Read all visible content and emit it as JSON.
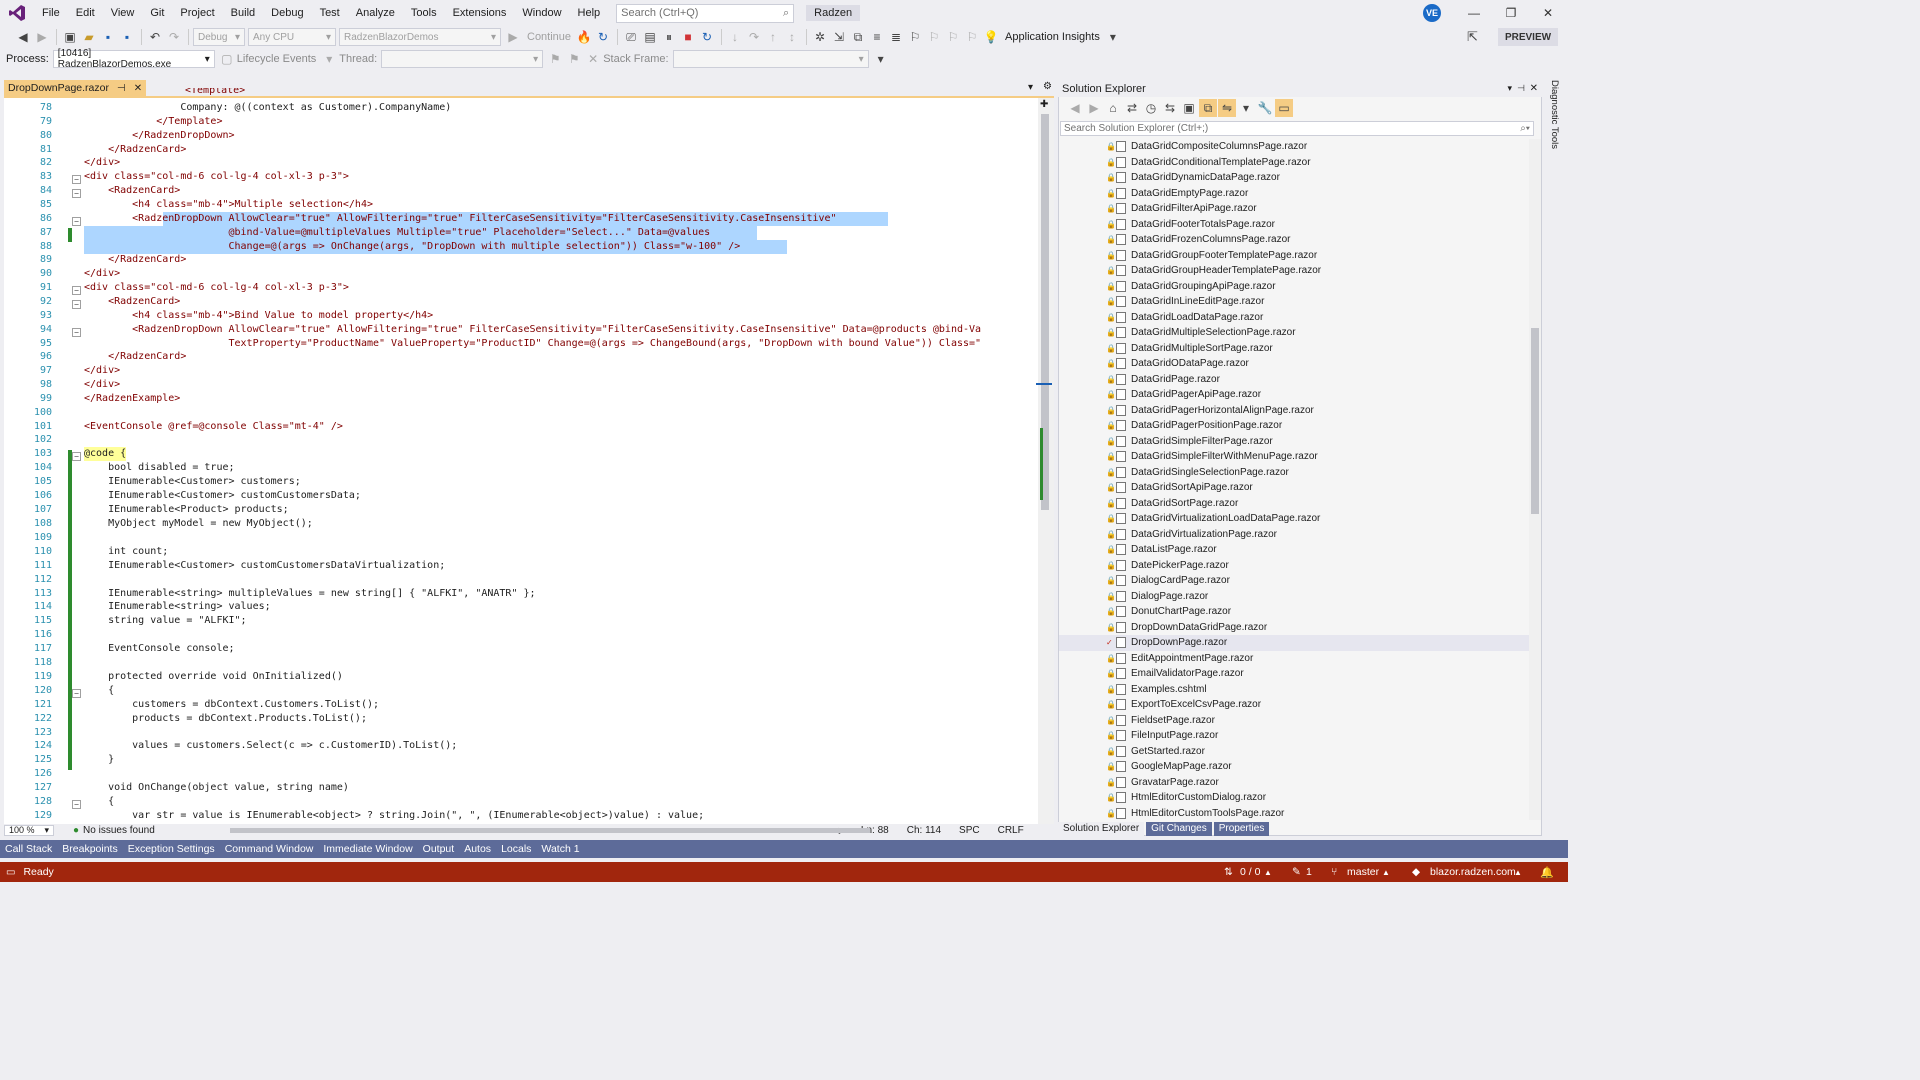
{
  "menubar": {
    "items": [
      "File",
      "Edit",
      "View",
      "Git",
      "Project",
      "Build",
      "Debug",
      "Test",
      "Analyze",
      "Tools",
      "Extensions",
      "Window",
      "Help"
    ],
    "search_placeholder": "Search (Ctrl+Q)",
    "app_name": "Radzen",
    "account_initials": "VE"
  },
  "toolbar": {
    "config": "Debug",
    "platform": "Any CPU",
    "project": "RadzenBlazorDemos",
    "continue_label": "Continue",
    "app_insights_label": "Application Insights",
    "preview_label": "PREVIEW"
  },
  "toolbar2": {
    "process_label": "Process:",
    "process_value": "[10416] RadzenBlazorDemos.exe",
    "lifecycle_label": "Lifecycle Events",
    "thread_label": "Thread:",
    "stackframe_label": "Stack Frame:"
  },
  "editor": {
    "tab_name": "DropDownPage.razor",
    "zoom": "100 %",
    "issues": "No issues found",
    "ln": "Ln: 88",
    "ch": "Ch: 114",
    "spc": "SPC",
    "crlf": "CRLF",
    "line_numbers": [
      "78",
      "79",
      "80",
      "81",
      "82",
      "83",
      "84",
      "85",
      "86",
      "87",
      "88",
      "89",
      "90",
      "91",
      "92",
      "93",
      "94",
      "95",
      "96",
      "97",
      "98",
      "99",
      "100",
      "101",
      "102",
      "103",
      "104",
      "105",
      "106",
      "107",
      "108",
      "109",
      "110",
      "111",
      "112",
      "113",
      "114",
      "115",
      "116",
      "117",
      "118",
      "119",
      "120",
      "121",
      "122",
      "123",
      "124",
      "125",
      "126",
      "127",
      "128",
      "129"
    ]
  },
  "code": {
    "l0": "<Template>",
    "l78": "                Company: @((context as Customer).CompanyName)",
    "l79": "            </Template>",
    "l80": "        </RadzenDropDown>",
    "l81": "    </RadzenCard>",
    "l82": "</div>",
    "l83": "<div class=\"col-md-6 col-lg-4 col-xl-3 p-3\">",
    "l84": "    <RadzenCard>",
    "l85": "        <h4 class=\"mb-4\">Multiple selection</h4>",
    "l86": "        <RadzenDropDown AllowClear=\"true\" AllowFiltering=\"true\" FilterCaseSensitivity=\"FilterCaseSensitivity.CaseInsensitive\"",
    "l87": "                        @bind-Value=@multipleValues Multiple=\"true\" Placeholder=\"Select...\" Data=@values",
    "l88": "                        Change=@(args => OnChange(args, \"DropDown with multiple selection\")) Class=\"w-100\" />",
    "l89": "    </RadzenCard>",
    "l90": "</div>",
    "l91": "<div class=\"col-md-6 col-lg-4 col-xl-3 p-3\">",
    "l92": "    <RadzenCard>",
    "l93": "        <h4 class=\"mb-4\">Bind Value to model property</h4>",
    "l94": "        <RadzenDropDown AllowClear=\"true\" AllowFiltering=\"true\" FilterCaseSensitivity=\"FilterCaseSensitivity.CaseInsensitive\" Data=@products @bind-Va",
    "l95": "                        TextProperty=\"ProductName\" ValueProperty=\"ProductID\" Change=@(args => ChangeBound(args, \"DropDown with bound Value\")) Class=\"",
    "l96": "    </RadzenCard>",
    "l97": "</div>",
    "l98": "</div>",
    "l99": "</RadzenExample>",
    "l101": "<EventConsole @ref=@console Class=\"mt-4\" />",
    "l103": "@code {",
    "l104": "    bool disabled = true;",
    "l105": "    IEnumerable<Customer> customers;",
    "l106": "    IEnumerable<Customer> customCustomersData;",
    "l107": "    IEnumerable<Product> products;",
    "l108": "    MyObject myModel = new MyObject();",
    "l110": "    int count;",
    "l111": "    IEnumerable<Customer> customCustomersDataVirtualization;",
    "l113": "    IEnumerable<string> multipleValues = new string[] { \"ALFKI\", \"ANATR\" };",
    "l114": "    IEnumerable<string> values;",
    "l115": "    string value = \"ALFKI\";",
    "l117": "    EventConsole console;",
    "l119": "    protected override void OnInitialized()",
    "l120": "    {",
    "l121": "        customers = dbContext.Customers.ToList();",
    "l122": "        products = dbContext.Products.ToList();",
    "l124": "        values = customers.Select(c => c.CustomerID).ToList();",
    "l125": "    }",
    "l127": "    void OnChange(object value, string name)",
    "l128": "    {",
    "l129": "        var str = value is IEnumerable<object> ? string.Join(\", \", (IEnumerable<object>)value) : value;"
  },
  "solution_explorer": {
    "title": "Solution Explorer",
    "search_placeholder": "Search Solution Explorer (Ctrl+;)",
    "files": [
      "DataGridCompositeColumnsPage.razor",
      "DataGridConditionalTemplatePage.razor",
      "DataGridDynamicDataPage.razor",
      "DataGridEmptyPage.razor",
      "DataGridFilterApiPage.razor",
      "DataGridFooterTotalsPage.razor",
      "DataGridFrozenColumnsPage.razor",
      "DataGridGroupFooterTemplatePage.razor",
      "DataGridGroupHeaderTemplatePage.razor",
      "DataGridGroupingApiPage.razor",
      "DataGridInLineEditPage.razor",
      "DataGridLoadDataPage.razor",
      "DataGridMultipleSelectionPage.razor",
      "DataGridMultipleSortPage.razor",
      "DataGridODataPage.razor",
      "DataGridPage.razor",
      "DataGridPagerApiPage.razor",
      "DataGridPagerHorizontalAlignPage.razor",
      "DataGridPagerPositionPage.razor",
      "DataGridSimpleFilterPage.razor",
      "DataGridSimpleFilterWithMenuPage.razor",
      "DataGridSingleSelectionPage.razor",
      "DataGridSortApiPage.razor",
      "DataGridSortPage.razor",
      "DataGridVirtualizationLoadDataPage.razor",
      "DataGridVirtualizationPage.razor",
      "DataListPage.razor",
      "DatePickerPage.razor",
      "DialogCardPage.razor",
      "DialogPage.razor",
      "DonutChartPage.razor",
      "DropDownDataGridPage.razor",
      "DropDownPage.razor",
      "EditAppointmentPage.razor",
      "EmailValidatorPage.razor",
      "Examples.cshtml",
      "ExportToExcelCsvPage.razor",
      "FieldsetPage.razor",
      "FileInputPage.razor",
      "GetStarted.razor",
      "GoogleMapPage.razor",
      "GravatarPage.razor",
      "HtmlEditorCustomDialog.razor",
      "HtmlEditorCustomToolsPage.razor"
    ],
    "current_index": 32,
    "tabs": [
      "Solution Explorer",
      "Git Changes",
      "Properties"
    ],
    "side_label": "Diagnostic Tools"
  },
  "bottom_tabs": [
    "Call Stack",
    "Breakpoints",
    "Exception Settings",
    "Command Window",
    "Immediate Window",
    "Output",
    "Autos",
    "Locals",
    "Watch 1"
  ],
  "status": {
    "ready": "Ready",
    "changes": "0 / 0",
    "edits": "1",
    "branch": "master",
    "repo": "blazor.radzen.com"
  },
  "colors": {
    "status_bar": "#a1260d",
    "selection": "#add6ff",
    "tab_active": "#f5cc84"
  }
}
